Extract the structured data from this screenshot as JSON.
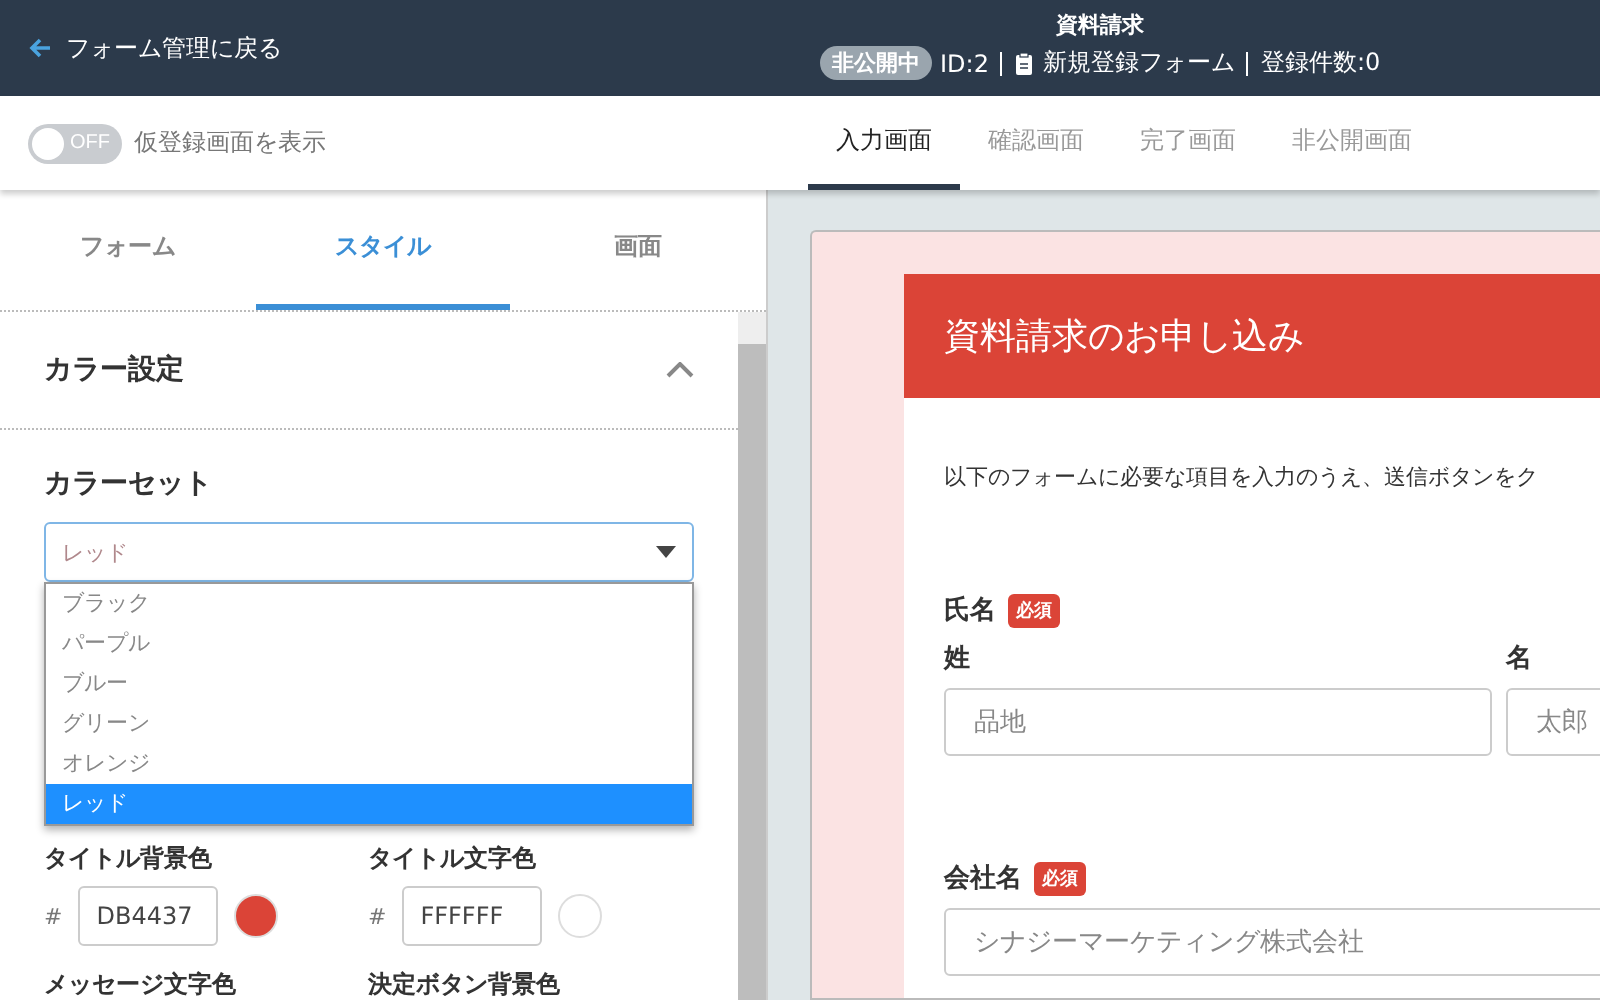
{
  "header": {
    "back_link": "フォーム管理に戻る",
    "title": "資料請求",
    "status_badge": "非公開中",
    "id": "ID:2",
    "form_name": "新規登録フォーム",
    "entry_count": "登録件数:0"
  },
  "toolbar": {
    "toggle": {
      "label": "OFF",
      "on": false
    },
    "toggle_caption": "仮登録画面を表示",
    "screen_tabs": [
      {
        "label": "入力画面",
        "selected": true
      },
      {
        "label": "確認画面",
        "selected": false
      },
      {
        "label": "完了画面",
        "selected": false
      },
      {
        "label": "非公開画面",
        "selected": false
      }
    ]
  },
  "sidebar": {
    "tabs": [
      {
        "label": "フォーム",
        "selected": false
      },
      {
        "label": "スタイル",
        "selected": true
      },
      {
        "label": "画面",
        "selected": false
      }
    ],
    "section": {
      "title": "カラー設定",
      "expanded": true
    },
    "color_set": {
      "label": "カラーセット",
      "value": "レッド",
      "options": [
        {
          "label": "ブラック",
          "selected": false
        },
        {
          "label": "パープル",
          "selected": false
        },
        {
          "label": "ブルー",
          "selected": false
        },
        {
          "label": "グリーン",
          "selected": false
        },
        {
          "label": "オレンジ",
          "selected": false
        },
        {
          "label": "レッド",
          "selected": true
        }
      ]
    },
    "color_fields": [
      {
        "label": "タイトル背景色",
        "hash": "#",
        "value": "DB4437",
        "color": "#db4437"
      },
      {
        "label": "タイトル文字色",
        "hash": "#",
        "value": "FFFFFF",
        "color": "#ffffff"
      },
      {
        "label": "メッセージ文字色"
      },
      {
        "label": "決定ボタン背景色"
      }
    ]
  },
  "preview": {
    "title": "資料請求のお申し込み",
    "description": "以下のフォームに必要な項目を入力のうえ、送信ボタンをク",
    "fields": [
      {
        "kind": "name",
        "label": "氏名",
        "required_badge": "必須",
        "parts": [
          {
            "label": "姓",
            "placeholder": "品地"
          },
          {
            "label": "名",
            "placeholder": "太郎"
          }
        ]
      },
      {
        "kind": "single",
        "label": "会社名",
        "required_badge": "必須",
        "placeholder": "シナジーマーケティング株式会社"
      }
    ]
  }
}
